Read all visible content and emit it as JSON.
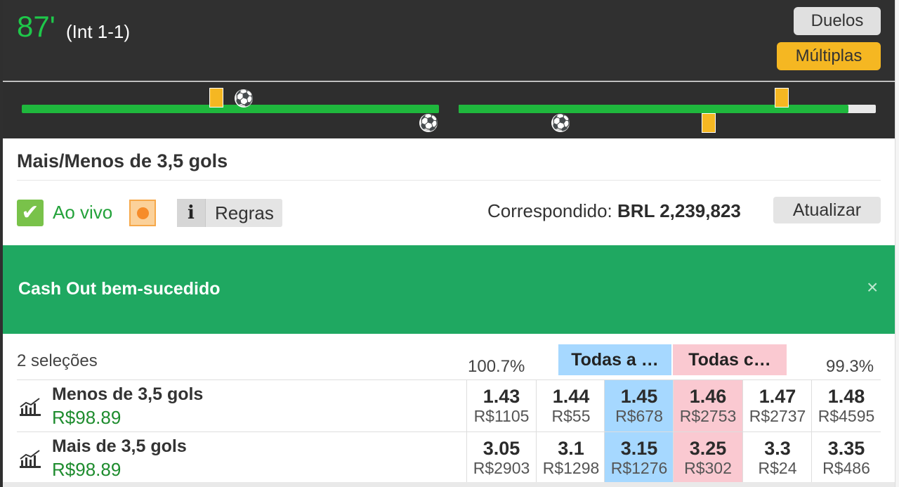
{
  "header": {
    "minute": "87'",
    "interval": "(Int 1-1)",
    "duelos_label": "Duelos",
    "multiplas_label": "Múltiplas"
  },
  "market": {
    "title": "Mais/Menos de 3,5 gols",
    "live_label": "Ao vivo",
    "rules_label": "Regras",
    "rules_icon_text": "i",
    "matched_label": "Correspondido:",
    "matched_value": "BRL 2,239,823",
    "refresh_label": "Atualizar"
  },
  "banner": {
    "text": "Cash Out bem-sucedido",
    "close_glyph": "×"
  },
  "ladder": {
    "selections": "2 seleções",
    "back_pct": "100.7%",
    "lay_pct": "99.3%",
    "all_back": "Todas a …",
    "all_lay": "Todas c…"
  },
  "runners": [
    {
      "name": "Menos de 3,5 gols",
      "pl": "R$98.89",
      "odds": [
        {
          "price": "1.43",
          "size": "R$1105"
        },
        {
          "price": "1.44",
          "size": "R$55"
        },
        {
          "price": "1.45",
          "size": "R$678"
        },
        {
          "price": "1.46",
          "size": "R$2753"
        },
        {
          "price": "1.47",
          "size": "R$2737"
        },
        {
          "price": "1.48",
          "size": "R$4595"
        }
      ]
    },
    {
      "name": "Mais de 3,5 gols",
      "pl": "R$98.89",
      "odds": [
        {
          "price": "3.05",
          "size": "R$2903"
        },
        {
          "price": "3.1",
          "size": "R$1298"
        },
        {
          "price": "3.15",
          "size": "R$1276"
        },
        {
          "price": "3.25",
          "size": "R$302"
        },
        {
          "price": "3.3",
          "size": "R$24"
        },
        {
          "price": "3.35",
          "size": "R$486"
        }
      ]
    }
  ],
  "colors": {
    "live_green": "#1ec84a",
    "banner_green": "#1fa861",
    "back_blue": "#a6d8ff",
    "lay_pink": "#fac9d1",
    "accent_yellow": "#f5b722",
    "pl_green": "#1e8c2e"
  },
  "icons": {
    "ball": "soccer-ball-icon",
    "card": "yellow-card-icon",
    "check": "checkmark-icon",
    "chart": "chart-icon",
    "close": "close-icon"
  }
}
